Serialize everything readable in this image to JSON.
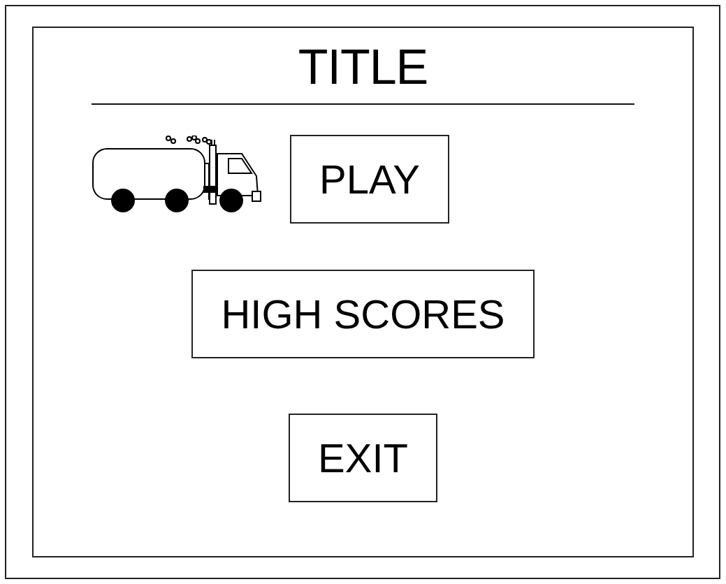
{
  "title": "TITLE",
  "buttons": [
    {
      "label": "PLAY"
    },
    {
      "label": "HIGH SCORES"
    },
    {
      "label": "EXIT"
    }
  ]
}
